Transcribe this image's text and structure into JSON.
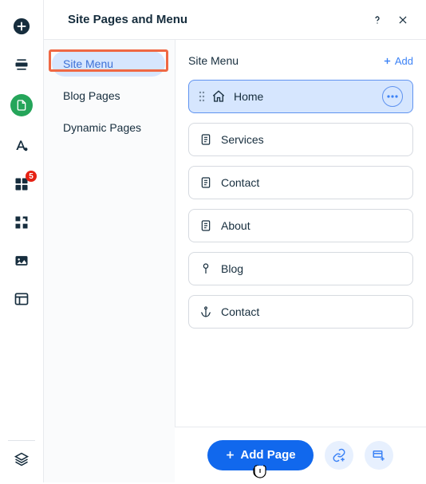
{
  "rail": {
    "badge_count": "5"
  },
  "header": {
    "title": "Site Pages and Menu"
  },
  "tabs": {
    "items": [
      {
        "label": "Site Menu",
        "selected": true,
        "highlighted": true
      },
      {
        "label": "Blog Pages",
        "selected": false,
        "highlighted": false
      },
      {
        "label": "Dynamic Pages",
        "selected": false,
        "highlighted": false
      }
    ]
  },
  "section": {
    "title": "Site Menu",
    "add_label": "Add"
  },
  "pages": [
    {
      "label": "Home",
      "icon": "home",
      "selected": true
    },
    {
      "label": "Services",
      "icon": "page",
      "selected": false
    },
    {
      "label": "Contact",
      "icon": "page",
      "selected": false
    },
    {
      "label": "About",
      "icon": "page",
      "selected": false
    },
    {
      "label": "Blog",
      "icon": "pin",
      "selected": false
    },
    {
      "label": "Contact",
      "icon": "anchor",
      "selected": false
    }
  ],
  "footer": {
    "add_page_label": "Add Page"
  }
}
